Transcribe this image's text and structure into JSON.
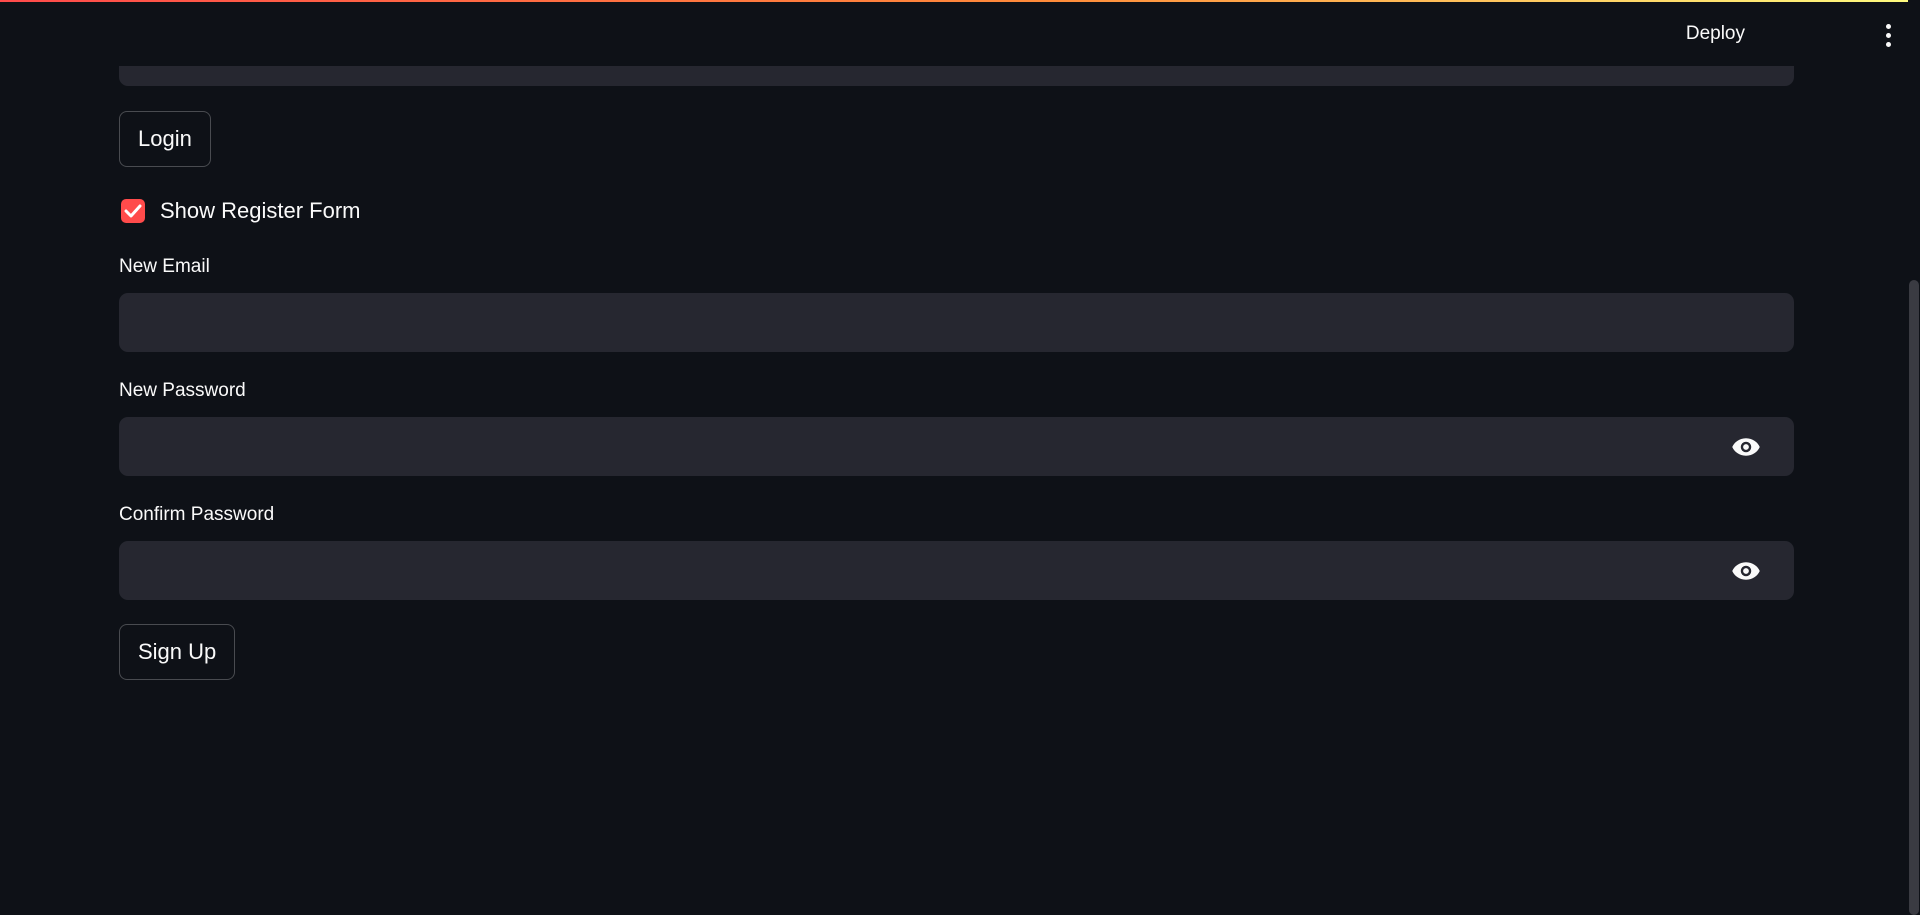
{
  "header": {
    "deploy_label": "Deploy",
    "menu_icon": "more-vertical-icon"
  },
  "login": {
    "button_label": "Login"
  },
  "register_toggle": {
    "label": "Show Register Form",
    "checked": true,
    "color": "#ff4b4b"
  },
  "register_form": {
    "email_label": "New Email",
    "email_value": "",
    "password_label": "New Password",
    "password_value": "",
    "confirm_label": "Confirm Password",
    "confirm_value": "",
    "signup_label": "Sign Up",
    "eye_icon": "eye-icon"
  },
  "theme": {
    "background": "#0e1117",
    "input_background": "#262730",
    "accent": "#ff4b4b"
  }
}
